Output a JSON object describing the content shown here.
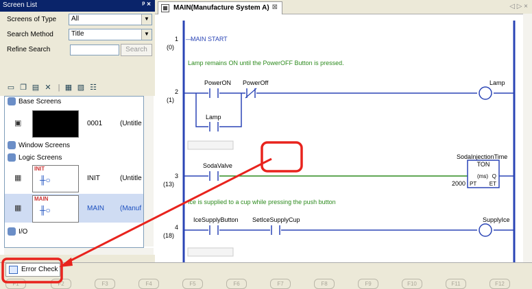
{
  "screen_list": {
    "title": "Screen List",
    "pin_label": "ᵖ ×",
    "type_label": "Screens of Type",
    "type_value": "All",
    "search_label": "Search Method",
    "search_value": "Title",
    "refine_label": "Refine Search",
    "refine_value": "",
    "search_button": "Search",
    "groups": {
      "base": "Base Screens",
      "window": "Window Screens",
      "logic": "Logic Screens",
      "io": "I/O"
    },
    "base_screen": {
      "number": "0001",
      "name": "(Untitle"
    },
    "logic_screens": [
      {
        "tag": "INIT",
        "name": "INIT",
        "title": "(Untitle"
      },
      {
        "tag": "MAIN",
        "name": "MAIN",
        "title": "(Manuf"
      }
    ]
  },
  "editor": {
    "tab_title": "MAIN(Manufacture System A)",
    "tab_nav": "◁ ▷ ×",
    "rungs": [
      {
        "number": "1",
        "step": "(0)",
        "label": "MAIN START",
        "comment": "Lamp remains ON until the PowerOFF Button is pressed."
      },
      {
        "number": "2",
        "step": "(1)",
        "contacts": [
          "PowerON",
          "PowerOff",
          "Lamp"
        ],
        "coil": "Lamp"
      },
      {
        "number": "3",
        "step": "(13)",
        "contact": "SodaValve",
        "timer_name": "SodaInjectionTime",
        "timer_type": "TON",
        "timer_unit": "(ms)",
        "timer_q": "Q",
        "timer_et": "ET",
        "timer_pt": "PT",
        "preset": "2000",
        "comment": "Ice is supplied to a cup while pressing the push button"
      },
      {
        "number": "4",
        "step": "(18)",
        "contacts": [
          "IceSupplyButton",
          "SetIceSupplyCup"
        ],
        "coil": "SupplyIce"
      }
    ]
  },
  "bottom": {
    "error_check": "Error Check",
    "fkeys": [
      "F1",
      "F2",
      "F3",
      "F4",
      "F5",
      "F6",
      "F7",
      "F8",
      "F9",
      "F10",
      "F11",
      "F12"
    ]
  },
  "colors": {
    "highlight": "#e8231d",
    "ladder_wire": "#2a44b5",
    "comment_green": "#2c8a1d",
    "title_bar": "#0a246a"
  }
}
